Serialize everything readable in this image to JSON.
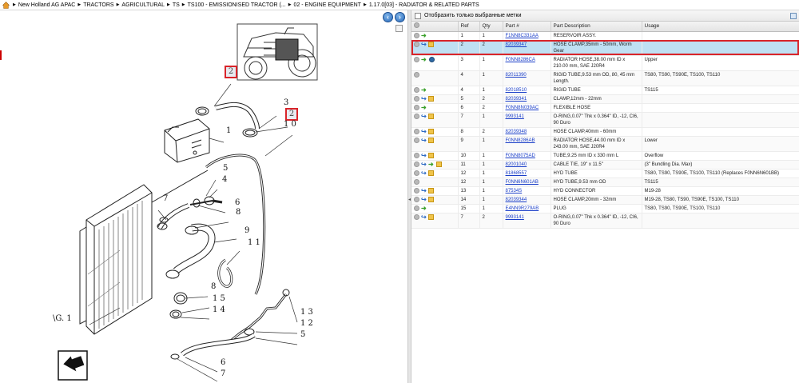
{
  "breadcrumb": [
    "New Holland AG APAC",
    "TRACTORS",
    "AGRICULTURAL",
    "TS",
    "TS100 - EMISSIONISED TRACTOR (...",
    "02 - ENGINE EQUIPMENT",
    "1.17.0[03] - RADIATOR & RELATED PARTS"
  ],
  "filter": {
    "label": "Отобразить только выбранные метки"
  },
  "table": {
    "headers": {
      "ref": "Ref",
      "qty": "Qty",
      "part": "Part #",
      "desc": "Part Description",
      "usage": "Usage"
    },
    "rows": [
      {
        "ref": "1",
        "qty": "1",
        "part": "F1NN8C331AA",
        "desc": "RESERVOIR ASSY.",
        "usage": "",
        "icons": [
          "info",
          "arrow-g"
        ]
      },
      {
        "ref": "2",
        "qty": "2",
        "part": "82039347",
        "desc": "HOSE CLAMP,35mm - 50mm, Worm Gear",
        "usage": "",
        "icons": [
          "info",
          "arrow-b",
          "box"
        ],
        "selected": true
      },
      {
        "ref": "3",
        "qty": "1",
        "part": "F0NN8286CA",
        "desc": "RADIATOR HOSE,38.00 mm ID x 210.00 mm, SAE J20R4",
        "usage": "Upper",
        "icons": [
          "info",
          "arrow-g",
          "globe"
        ]
      },
      {
        "ref": "4",
        "qty": "1",
        "part": "82011390",
        "desc": "RIGID TUBE,9.53 mm OD, 80, 45 mm Length.",
        "usage": "TS80, TS90, TS90E, TS100, TS110",
        "icons": [
          "info"
        ]
      },
      {
        "ref": "4",
        "qty": "1",
        "part": "82018510",
        "desc": "RIGID TUBE",
        "usage": "TS115",
        "icons": [
          "info",
          "arrow-g"
        ]
      },
      {
        "ref": "5",
        "qty": "2",
        "part": "82039341",
        "desc": "CLAMP,12mm - 22mm",
        "usage": "",
        "icons": [
          "info",
          "arrow-b",
          "box"
        ]
      },
      {
        "ref": "6",
        "qty": "2",
        "part": "F0NN8N039AC",
        "desc": "FLEXIBLE HOSE",
        "usage": "",
        "icons": [
          "info",
          "arrow-g"
        ]
      },
      {
        "ref": "7",
        "qty": "1",
        "part": "9993141",
        "desc": "O-RING,0.07\" Thk x 0.364\" ID, -12, CI6, 90 Duro",
        "usage": "",
        "icons": [
          "info",
          "arrow-b",
          "box"
        ]
      },
      {
        "ref": "8",
        "qty": "2",
        "part": "82039348",
        "desc": "HOSE CLAMP,40mm - 60mm",
        "usage": "",
        "icons": [
          "info",
          "arrow-b",
          "box"
        ]
      },
      {
        "ref": "9",
        "qty": "1",
        "part": "F0NN8286AB",
        "desc": "RADIATOR HOSE,44.00 mm ID x 243.00 mm, SAE J20R4",
        "usage": "Lower",
        "icons": [
          "info",
          "arrow-b",
          "box"
        ]
      },
      {
        "ref": "10",
        "qty": "1",
        "part": "F0NN8075AD",
        "desc": "TUBE,9.25 mm ID x 330 mm L",
        "usage": "Overflow",
        "icons": [
          "info",
          "arrow-b",
          "box"
        ]
      },
      {
        "ref": "11",
        "qty": "1",
        "part": "82001040",
        "desc": "CABLE TIE, 19\" x 11.5\"",
        "usage": "(3\" Bundling Dia. Max)",
        "icons": [
          "info",
          "arrow-b",
          "arrow-g",
          "box"
        ]
      },
      {
        "ref": "12",
        "qty": "1",
        "part": "81868557",
        "desc": "HYD TUBE",
        "usage": "TS80, TS90, TS90E, TS100, TS110 (Replaces F0NN6N601BB)",
        "icons": [
          "info",
          "arrow-b",
          "box"
        ]
      },
      {
        "ref": "12",
        "qty": "1",
        "part": "F0NN6N601AB",
        "desc": "HYD TUBE,9.53 mm OD",
        "usage": "TS115",
        "icons": [
          "info"
        ]
      },
      {
        "ref": "13",
        "qty": "1",
        "part": "87534S",
        "desc": "HYD CONNECTOR",
        "usage": "M19-28",
        "icons": [
          "info",
          "arrow-b",
          "box"
        ]
      },
      {
        "ref": "14",
        "qty": "1",
        "part": "82039344",
        "desc": "HOSE CLAMP,20mm - 32mm",
        "usage": "M19-28, TS80, TS90, TS90E, TS100, TS110",
        "icons": [
          "info",
          "arrow-b",
          "box"
        ]
      },
      {
        "ref": "15",
        "qty": "1",
        "part": "E4NN9R279AB",
        "desc": "PLUG",
        "usage": "TS80, TS90, TS90E, TS100, TS110",
        "icons": [
          "info",
          "arrow-g"
        ]
      },
      {
        "ref": "7",
        "qty": "2",
        "part": "9993141",
        "desc": "O-RING,0.07\" Thk x 0.364\" ID, -12, CI6, 90 Duro",
        "usage": "",
        "icons": [
          "info",
          "arrow-b",
          "box"
        ]
      }
    ]
  },
  "diagram": {
    "fig_label": "\\G.  1",
    "callouts": [
      {
        "text": "2",
        "highlight": true
      },
      {
        "text": "2",
        "highlight": true
      },
      {
        "text": "3"
      },
      {
        "text": "1 0"
      },
      {
        "text": "1"
      },
      {
        "text": "5"
      },
      {
        "text": "4"
      },
      {
        "text": "7"
      },
      {
        "text": "6"
      },
      {
        "text": "8"
      },
      {
        "text": "9"
      },
      {
        "text": "1 1"
      },
      {
        "text": "8"
      },
      {
        "text": "1 5"
      },
      {
        "text": "1 4"
      },
      {
        "text": "1 3"
      },
      {
        "text": "1 2"
      },
      {
        "text": "5"
      },
      {
        "text": "6"
      },
      {
        "text": "7"
      }
    ]
  },
  "colors": {
    "highlight": "#d9242a",
    "selected_row": "#bfe0f3",
    "link": "#1a3ec8"
  }
}
